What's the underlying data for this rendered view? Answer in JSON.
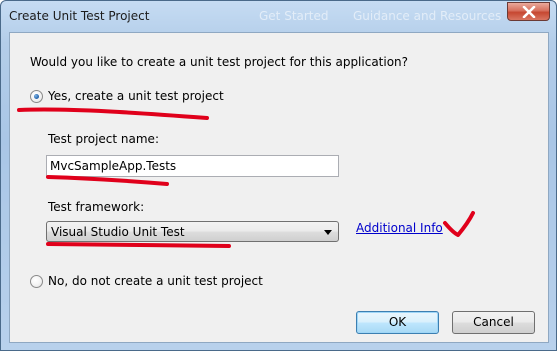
{
  "window": {
    "title": "Create Unit Test Project",
    "background_tabs": [
      "Get Started",
      "Guidance and Resources"
    ]
  },
  "dialog": {
    "question": "Would you like to create a unit test project for this application?",
    "option_yes": {
      "label": "Yes, create a unit test project",
      "selected": true
    },
    "project_name": {
      "label": "Test project name:",
      "value": "MvcSampleApp.Tests"
    },
    "framework": {
      "label": "Test framework:",
      "selected": "Visual Studio Unit Test"
    },
    "additional_info_link": "Additional Info",
    "option_no": {
      "label": "No, do not create a unit test project",
      "selected": false
    }
  },
  "buttons": {
    "ok": "OK",
    "cancel": "Cancel"
  },
  "colors": {
    "annotation_red": "#e0001b",
    "link_blue": "#0000cc",
    "title_bar": "#b3cde9",
    "dialog_bg": "#f0f0f0"
  },
  "icons": [
    "close-icon",
    "dropdown-arrow-icon",
    "radio-selected",
    "radio-unselected"
  ]
}
